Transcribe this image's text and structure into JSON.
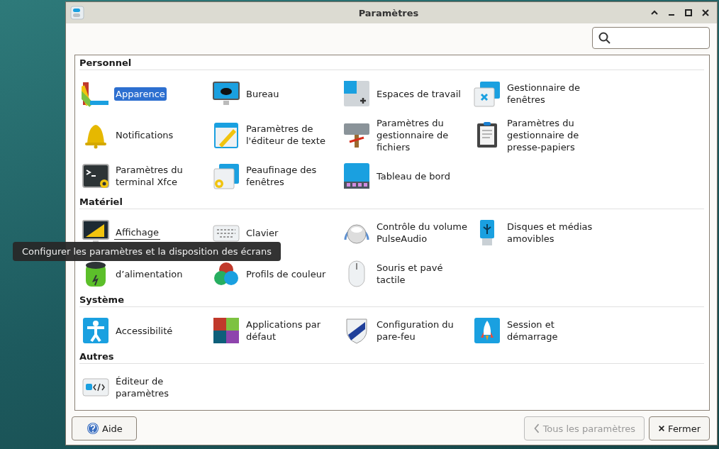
{
  "window": {
    "title": "Paramètres"
  },
  "sections": [
    {
      "title": "Personnel",
      "items": [
        {
          "label": "Apparence",
          "selected": true,
          "hovered": false
        },
        {
          "label": "Bureau",
          "selected": false,
          "hovered": false
        },
        {
          "label": "Espaces de travail",
          "selected": false,
          "hovered": false
        },
        {
          "label": "Gestionnaire de fenêtres",
          "selected": false,
          "hovered": false
        },
        {
          "label": "Notifications",
          "selected": false,
          "hovered": false
        },
        {
          "label": "Paramètres de l'éditeur de texte",
          "selected": false,
          "hovered": false
        },
        {
          "label": "Paramètres du gestionnaire de fichiers",
          "selected": false,
          "hovered": false
        },
        {
          "label": "Paramètres du gestionnaire de presse-papiers",
          "selected": false,
          "hovered": false
        },
        {
          "label": "Paramètres du terminal Xfce",
          "selected": false,
          "hovered": false
        },
        {
          "label": "Peaufinage des fenêtres",
          "selected": false,
          "hovered": false
        },
        {
          "label": "Tableau de bord",
          "selected": false,
          "hovered": false
        }
      ]
    },
    {
      "title": "Matériel",
      "items": [
        {
          "label": "Affichage",
          "selected": false,
          "hovered": true
        },
        {
          "label": "Clavier",
          "selected": false,
          "hovered": false
        },
        {
          "label": "Contrôle du volume PulseAudio",
          "selected": false,
          "hovered": false
        },
        {
          "label": "Disques et médias amovibles",
          "selected": false,
          "hovered": false
        },
        {
          "label": "d’alimentation",
          "selected": false,
          "hovered": false
        },
        {
          "label": "Profils de couleur",
          "selected": false,
          "hovered": false
        },
        {
          "label": "Souris et pavé tactile",
          "selected": false,
          "hovered": false
        }
      ]
    },
    {
      "title": "Système",
      "items": [
        {
          "label": "Accessibilité",
          "selected": false,
          "hovered": false
        },
        {
          "label": "Applications par défaut",
          "selected": false,
          "hovered": false
        },
        {
          "label": "Configuration du pare-feu",
          "selected": false,
          "hovered": false
        },
        {
          "label": "Session et démarrage",
          "selected": false,
          "hovered": false
        }
      ]
    },
    {
      "title": "Autres",
      "items": [
        {
          "label": "Éditeur de paramètres",
          "selected": false,
          "hovered": false
        }
      ]
    }
  ],
  "tooltip": "Configurer les paramètres et la disposition des écrans",
  "buttons": [
    {
      "kind": "help",
      "label": "Aide",
      "disabled": false
    },
    {
      "kind": "back",
      "label": "Tous les paramètres",
      "disabled": true
    },
    {
      "kind": "close",
      "label": "Fermer",
      "disabled": false
    }
  ]
}
